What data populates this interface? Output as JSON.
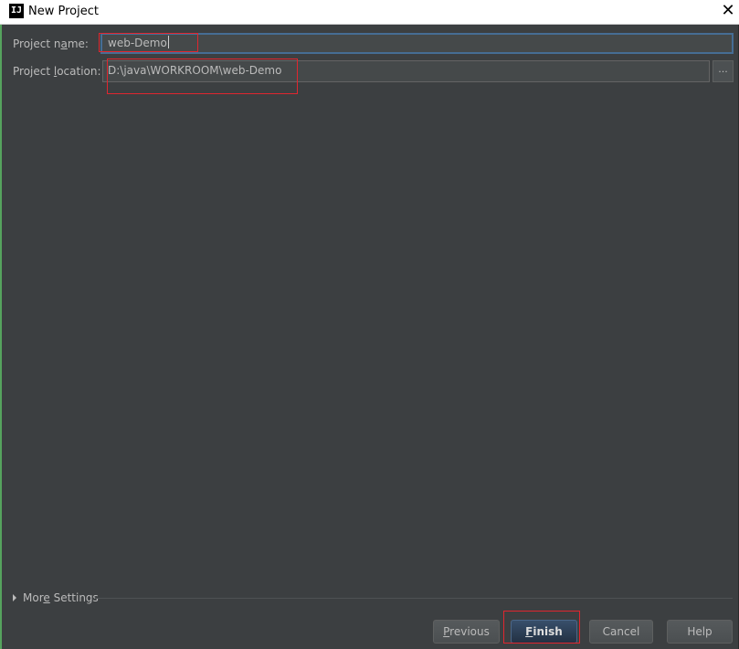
{
  "window": {
    "title": "New Project",
    "app_icon_glyph": "IJ",
    "close_glyph": "✕"
  },
  "form": {
    "name_label_pre": "Project n",
    "name_label_mnemonic": "a",
    "name_label_post": "me:",
    "name_value": "web-Demo",
    "location_label_pre": "Project ",
    "location_label_mnemonic": "l",
    "location_label_post": "ocation:",
    "location_value": "D:\\java\\WORKROOM\\web-Demo",
    "browse_label": "..."
  },
  "more_settings": {
    "label_pre": "Mor",
    "label_mnemonic": "e",
    "label_post": " Settings"
  },
  "buttons": {
    "previous_mnemonic": "P",
    "previous_rest": "revious",
    "finish_mnemonic": "F",
    "finish_rest": "inish",
    "cancel": "Cancel",
    "help": "Help"
  },
  "colors": {
    "background": "#3c3f41",
    "text": "#bbbbbb",
    "focus_border": "#466d94",
    "annotation": "#e0262f"
  }
}
